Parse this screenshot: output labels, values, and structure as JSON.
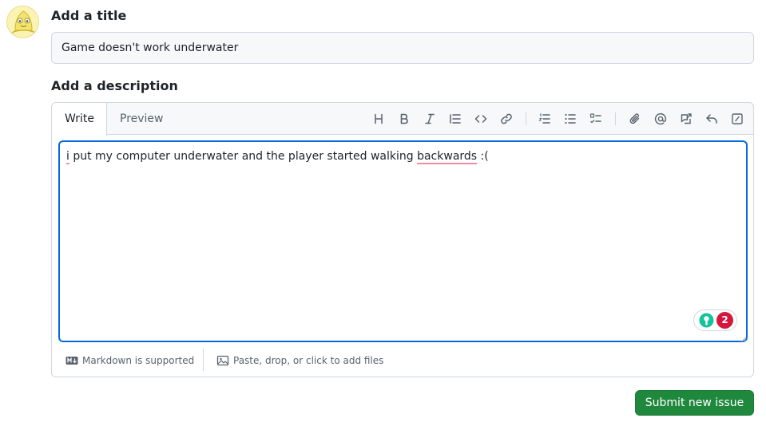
{
  "avatar": {
    "label": "user-avatar"
  },
  "title_section": {
    "label": "Add a title",
    "value": "Game doesn't work underwater"
  },
  "description_section": {
    "label": "Add a description",
    "tabs": [
      {
        "label": "Write",
        "active": true
      },
      {
        "label": "Preview",
        "active": false
      }
    ],
    "toolbar": [
      "heading-icon",
      "bold-icon",
      "italic-icon",
      "quote-icon",
      "code-icon",
      "link-icon",
      "ordered-list-icon",
      "unordered-list-icon",
      "task-list-icon",
      "attach-icon",
      "mention-icon",
      "reference-icon",
      "reply-icon",
      "slash-commands-icon"
    ],
    "body": {
      "word_1": "i",
      "text_1": " put my computer underwater and the player started walking ",
      "word_2": "backwards",
      "text_2": " :("
    },
    "grammar_badge": {
      "count": "2"
    },
    "footer": {
      "markdown": "Markdown is supported",
      "files": "Paste, drop, or click to add files"
    }
  },
  "actions": {
    "submit": "Submit new issue"
  },
  "colors": {
    "accent": "#0969da",
    "submit_bg": "#1f883d",
    "badge_red": "#d4183d",
    "spell_underline": "#f28ba0"
  }
}
